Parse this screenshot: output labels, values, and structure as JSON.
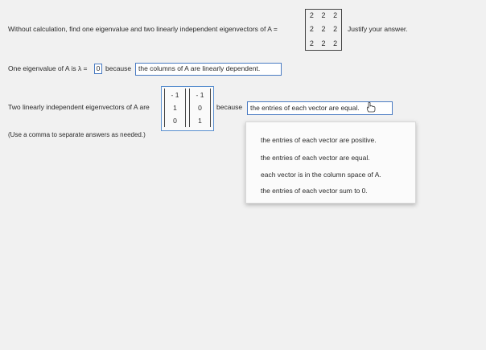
{
  "question": {
    "prompt": "Without calculation, find one eigenvalue and two linearly independent eigenvectors of A =",
    "justify": "Justify your answer.",
    "matrix_A": [
      [
        "2",
        "2",
        "2"
      ],
      [
        "2",
        "2",
        "2"
      ],
      [
        "2",
        "2",
        "2"
      ]
    ]
  },
  "eigenvalue_row": {
    "prefix": "One eigenvalue of A is λ =",
    "value": "0",
    "because": "because",
    "reason": "the columns of A are linearly dependent."
  },
  "eigenvector_row": {
    "prefix": "Two linearly independent eigenvectors of A are",
    "vector1": [
      "- 1",
      "1",
      "0"
    ],
    "vector2": [
      "- 1",
      "0",
      "1"
    ],
    "because": "because",
    "reason": "the entries of each vector are equal."
  },
  "hint": "(Use a comma to separate answers as needed.)",
  "dropdown": {
    "options": [
      "the entries of each vector are positive.",
      "the entries of each vector are equal.",
      "each vector is in the column space of A.",
      "the entries of each vector sum to 0."
    ]
  },
  "colors": {
    "input_border": "#4a7bc2",
    "text": "#2a2a2a",
    "background": "#f1f1f1"
  }
}
